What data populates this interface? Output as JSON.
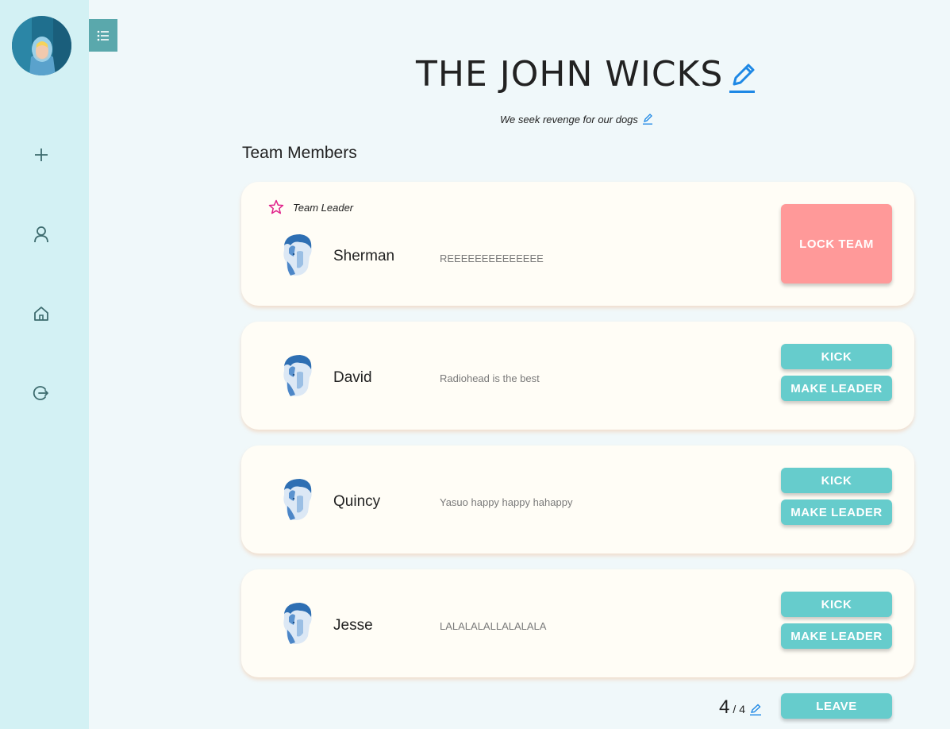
{
  "sidebar": {
    "icons": [
      "add-icon",
      "user-icon",
      "home-icon",
      "logout-icon"
    ]
  },
  "team": {
    "name": "THE JOHN WICKS",
    "motto": "We seek revenge for our dogs"
  },
  "section_title": "Team Members",
  "leader_label": "Team Leader",
  "members": [
    {
      "name": "Sherman",
      "motto": "REEEEEEEEEEEEEE",
      "is_leader": true
    },
    {
      "name": "David",
      "motto": "Radiohead is the best",
      "is_leader": false
    },
    {
      "name": "Quincy",
      "motto": "Yasuo happy happy hahappy",
      "is_leader": false
    },
    {
      "name": "Jesse",
      "motto": "LALALALALLALALALA",
      "is_leader": false
    }
  ],
  "buttons": {
    "lock": "LOCK TEAM",
    "kick": "KICK",
    "make_leader": "MAKE LEADER",
    "leave": "LEAVE"
  },
  "member_count": {
    "current": "4",
    "separator": "/",
    "max": "4"
  },
  "colors": {
    "sidebar_bg": "#d3f1f4",
    "accent_teal": "#66cccc",
    "lock_red": "#ff9999",
    "edit_blue": "#1e88e5",
    "star_pink": "#e0208a"
  }
}
